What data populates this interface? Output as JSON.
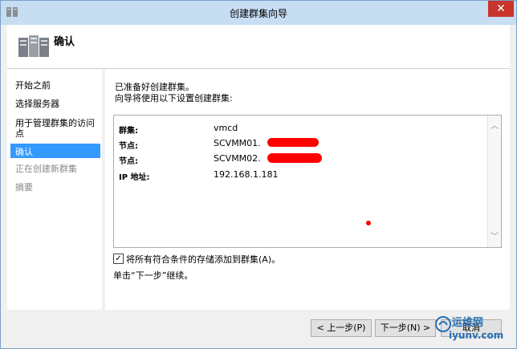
{
  "window": {
    "title": "创建群集向导",
    "close_glyph": "✕"
  },
  "header": {
    "title": "确认"
  },
  "nav": {
    "items": [
      {
        "label": "开始之前",
        "state": "normal"
      },
      {
        "label": "选择服务器",
        "state": "normal"
      },
      {
        "label": "用于管理群集的访问",
        "state": "normal"
      },
      {
        "label": "点",
        "state": "normal"
      },
      {
        "label": "确认",
        "state": "selected"
      },
      {
        "label": "正在创建新群集",
        "state": "disabled"
      },
      {
        "label": "摘要",
        "state": "disabled"
      }
    ]
  },
  "main": {
    "lead1": "已准备好创建群集。",
    "lead2": "向导将使用以下设置创建群集:",
    "summary": [
      {
        "label": "群集:",
        "value": "vmcd"
      },
      {
        "label": "节点:",
        "value": "SCVMM01."
      },
      {
        "label": "节点:",
        "value": "SCVMM02."
      },
      {
        "label": "IP 地址:",
        "value": "192.168.1.181"
      }
    ],
    "checkbox_label": "将所有符合条件的存储添加到群集(A)。",
    "checkbox_checked": true,
    "checkbox_glyph": "✓",
    "hint": "单击“下一步”继续。"
  },
  "footer": {
    "prev_label": "< 上一步(P)",
    "next_label": "下一步(N) >",
    "cancel_label": "取消"
  },
  "watermark": {
    "line1": "运维网",
    "line2": "iyunv.com"
  },
  "colors": {
    "selected_bg": "#3399ff",
    "close_bg": "#c7352b",
    "redaction": "#ff0000"
  }
}
